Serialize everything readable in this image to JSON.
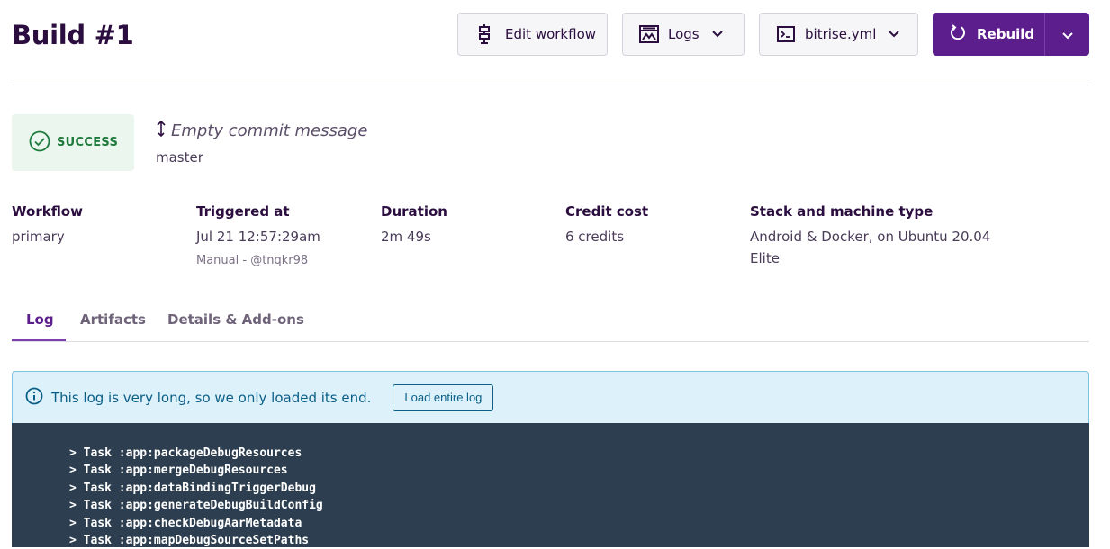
{
  "header": {
    "title": "Build #1",
    "edit_workflow_label": "Edit workflow",
    "logs_label": "Logs",
    "yml_label": "bitrise.yml",
    "rebuild_label": "Rebuild"
  },
  "status": {
    "label": "SUCCESS",
    "commit_message": "Empty commit message",
    "branch": "master"
  },
  "meta": {
    "workflow_label": "Workflow",
    "workflow_value": "primary",
    "triggered_label": "Triggered at",
    "triggered_value": "Jul 21 12:57:29am",
    "triggered_sub": "Manual - @tnqkr98",
    "duration_label": "Duration",
    "duration_value": "2m 49s",
    "credit_label": "Credit cost",
    "credit_value": "6 credits",
    "stack_label": "Stack and machine type",
    "stack_value": "Android & Docker, on Ubuntu 20.04",
    "machine_value": "Elite"
  },
  "tabs": [
    {
      "label": "Log"
    },
    {
      "label": "Artifacts"
    },
    {
      "label": "Details & Add-ons"
    }
  ],
  "notice": {
    "message": "This log is very long, so we only loaded its end.",
    "button_label": "Load entire log"
  },
  "log": {
    "lines": [
      "> Task :app:packageDebugResources",
      "> Task :app:mergeDebugResources",
      "> Task :app:dataBindingTriggerDebug",
      "> Task :app:generateDebugBuildConfig",
      "> Task :app:checkDebugAarMetadata",
      "> Task :app:mapDebugSourceSetPaths"
    ]
  },
  "colors": {
    "brand": "#5c1e8c",
    "success": "#1e7a3c",
    "info": "#0b5f87",
    "log_bg": "#2c3e4f"
  },
  "icons": [
    "stack-icon",
    "logs-icon",
    "terminal-icon",
    "rebuild-icon",
    "chevron-down-icon",
    "check-circle-icon",
    "commit-arrow-icon",
    "info-icon"
  ]
}
